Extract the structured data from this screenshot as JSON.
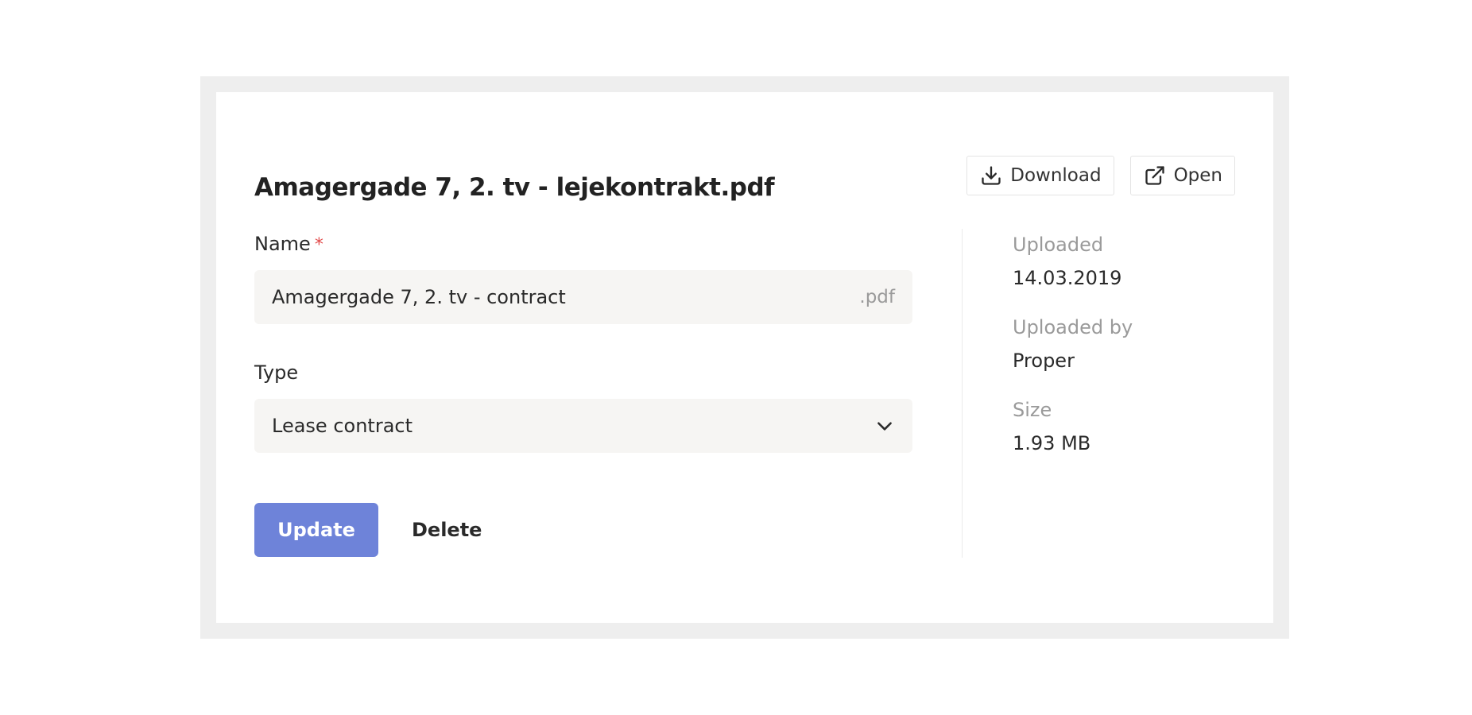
{
  "document": {
    "title": "Amagergade 7, 2. tv - lejekontrakt.pdf"
  },
  "actions": {
    "download_label": "Download",
    "open_label": "Open"
  },
  "form": {
    "name_label": "Name",
    "required_marker": "*",
    "name_value": "Amagergade 7, 2. tv - contract",
    "name_suffix": ".pdf",
    "type_label": "Type",
    "type_value": "Lease contract",
    "update_label": "Update",
    "delete_label": "Delete"
  },
  "meta": {
    "uploaded_label": "Uploaded",
    "uploaded_value": "14.03.2019",
    "uploaded_by_label": "Uploaded by",
    "uploaded_by_value": "Proper",
    "size_label": "Size",
    "size_value": "1.93 MB"
  },
  "icons": {
    "download": "download-icon",
    "open": "external-link-icon",
    "select": "chevron-down-icon"
  },
  "colors": {
    "primary": "#6e83d9",
    "required": "#e24b4b",
    "input_bg": "#f6f5f3",
    "frame": "#eeeeee"
  }
}
